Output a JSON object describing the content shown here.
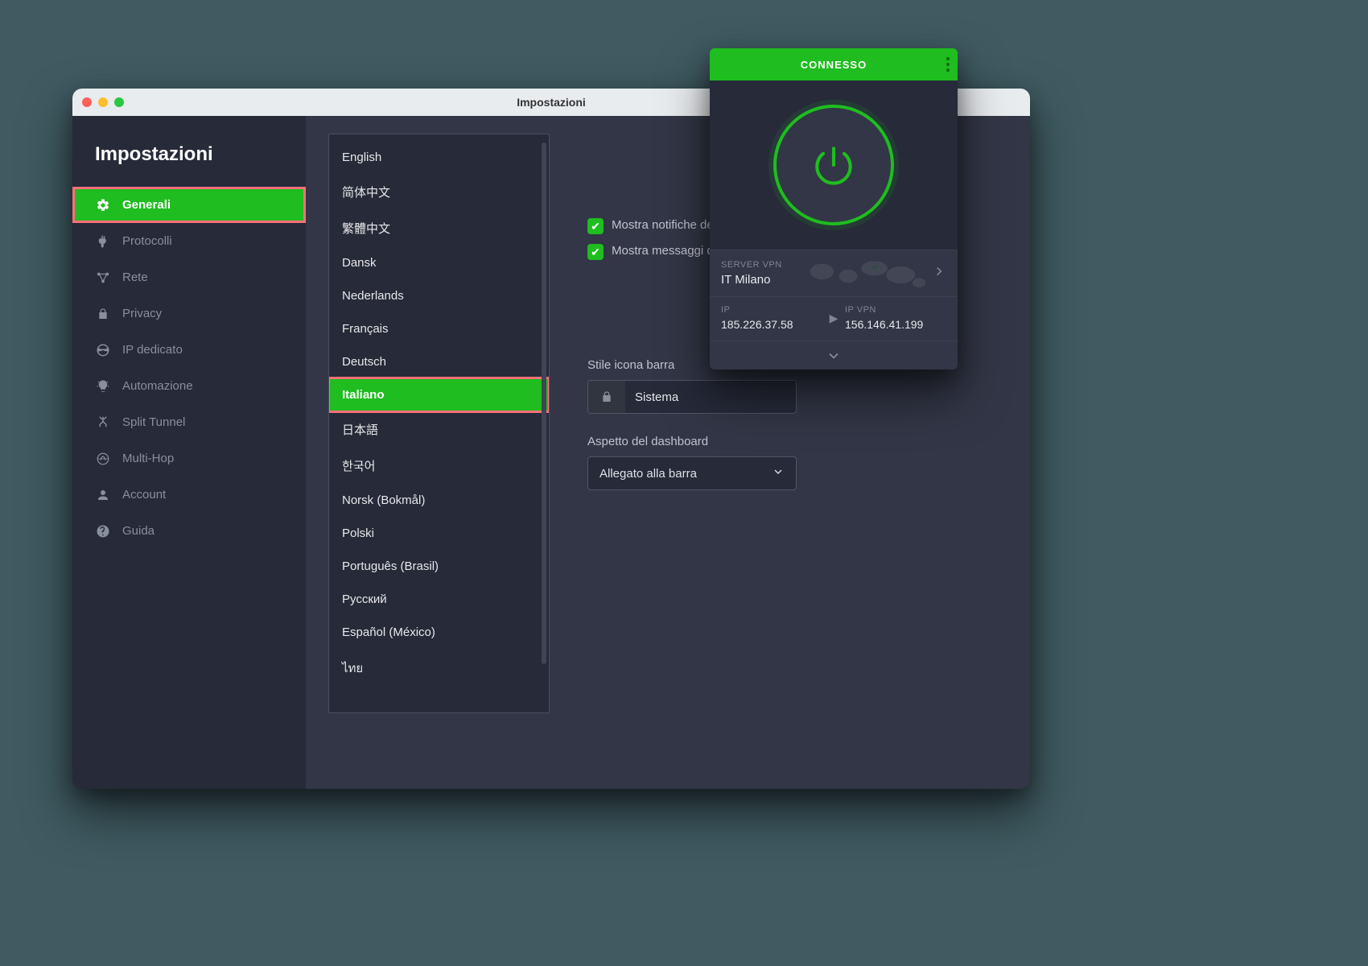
{
  "window": {
    "title": "Impostazioni"
  },
  "sidebar": {
    "heading": "Impostazioni",
    "items": [
      {
        "label": "Generali"
      },
      {
        "label": "Protocolli"
      },
      {
        "label": "Rete"
      },
      {
        "label": "Privacy"
      },
      {
        "label": "IP dedicato"
      },
      {
        "label": "Automazione"
      },
      {
        "label": "Split Tunnel"
      },
      {
        "label": "Multi-Hop"
      },
      {
        "label": "Account"
      },
      {
        "label": "Guida"
      }
    ]
  },
  "languages": [
    "English",
    "简体中文",
    "繁體中文",
    "Dansk",
    "Nederlands",
    "Français",
    "Deutsch",
    "Italiano",
    "日本語",
    "한국어",
    "Norsk (Bokmål)",
    "Polski",
    "Português (Brasil)",
    "Русский",
    "Español (México)",
    "ไทย"
  ],
  "options": {
    "notify_label": "Mostra notifiche del desktop",
    "service_msgs_label": "Mostra messaggi di servizio",
    "icon_style_section": "Stile icona barra",
    "icon_style_value": "Sistema",
    "dashboard_section": "Aspetto del dashboard",
    "dashboard_value": "Allegato alla barra"
  },
  "mini": {
    "status": "CONNESSO",
    "server_label": "SERVER VPN",
    "server_value": "IT Milano",
    "ip_label": "IP",
    "ip_value": "185.226.37.58",
    "ipvpn_label": "IP VPN",
    "ipvpn_value": "156.146.41.199"
  }
}
